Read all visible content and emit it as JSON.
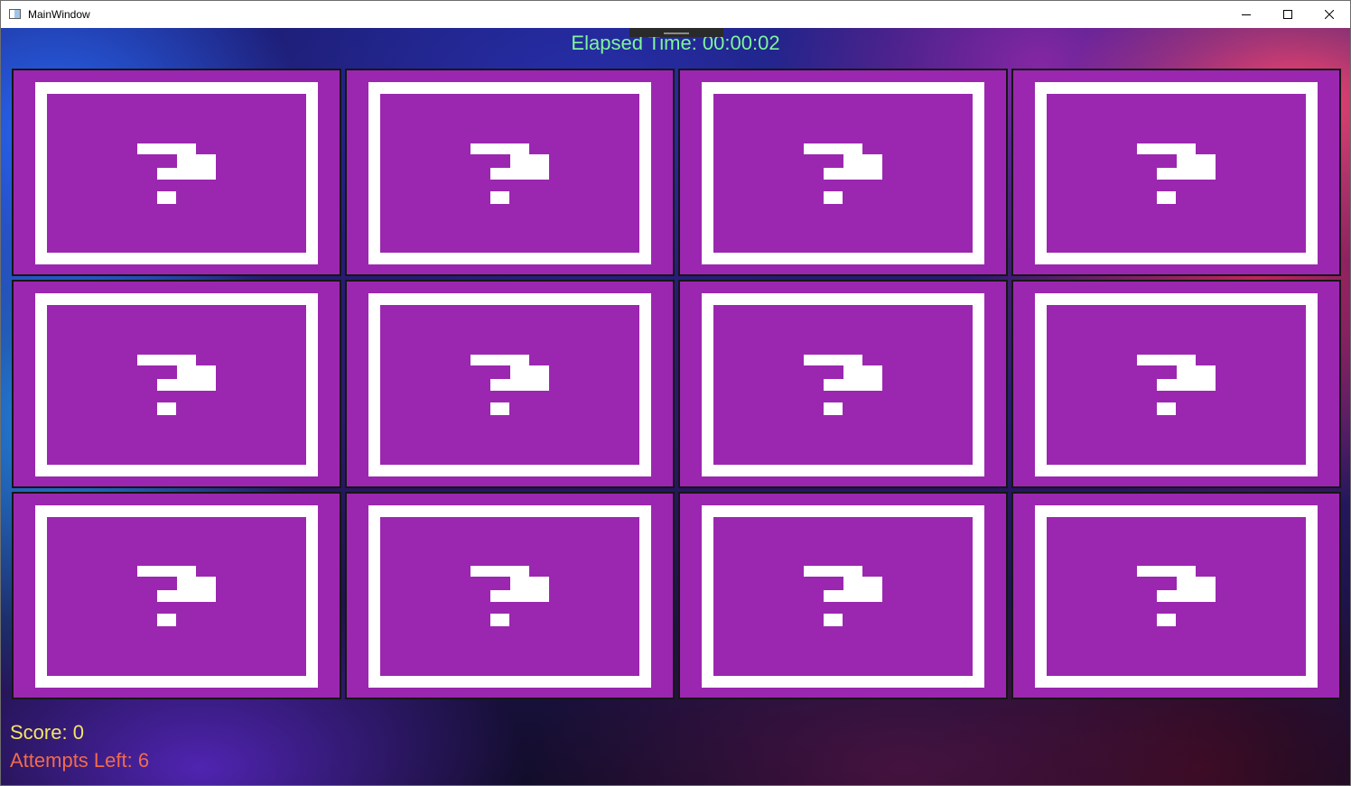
{
  "window": {
    "title": "MainWindow",
    "icon": "app-window-icon",
    "controls": {
      "minimize": "minimize-icon",
      "maximize": "maximize-icon",
      "close": "close-icon"
    }
  },
  "game": {
    "elapsed_label": "Elapsed Time: 00:00:02",
    "score_label": "Score: 0",
    "attempts_label": "Attempts Left: 6",
    "colors": {
      "card_face": "#9b27b0",
      "card_frame": "#ffffff",
      "elapsed_text": "#7ff59a",
      "score_text": "#f3e46a",
      "attempts_text": "#f26b4b"
    },
    "grid": {
      "rows": 3,
      "columns": 4
    },
    "cards": [
      {
        "state": "face-down",
        "icon": "question-mark-icon"
      },
      {
        "state": "face-down",
        "icon": "question-mark-icon"
      },
      {
        "state": "face-down",
        "icon": "question-mark-icon"
      },
      {
        "state": "face-down",
        "icon": "question-mark-icon"
      },
      {
        "state": "face-down",
        "icon": "question-mark-icon"
      },
      {
        "state": "face-down",
        "icon": "question-mark-icon"
      },
      {
        "state": "face-down",
        "icon": "question-mark-icon"
      },
      {
        "state": "face-down",
        "icon": "question-mark-icon"
      },
      {
        "state": "face-down",
        "icon": "question-mark-icon"
      },
      {
        "state": "face-down",
        "icon": "question-mark-icon"
      },
      {
        "state": "face-down",
        "icon": "question-mark-icon"
      },
      {
        "state": "face-down",
        "icon": "question-mark-icon"
      }
    ]
  }
}
